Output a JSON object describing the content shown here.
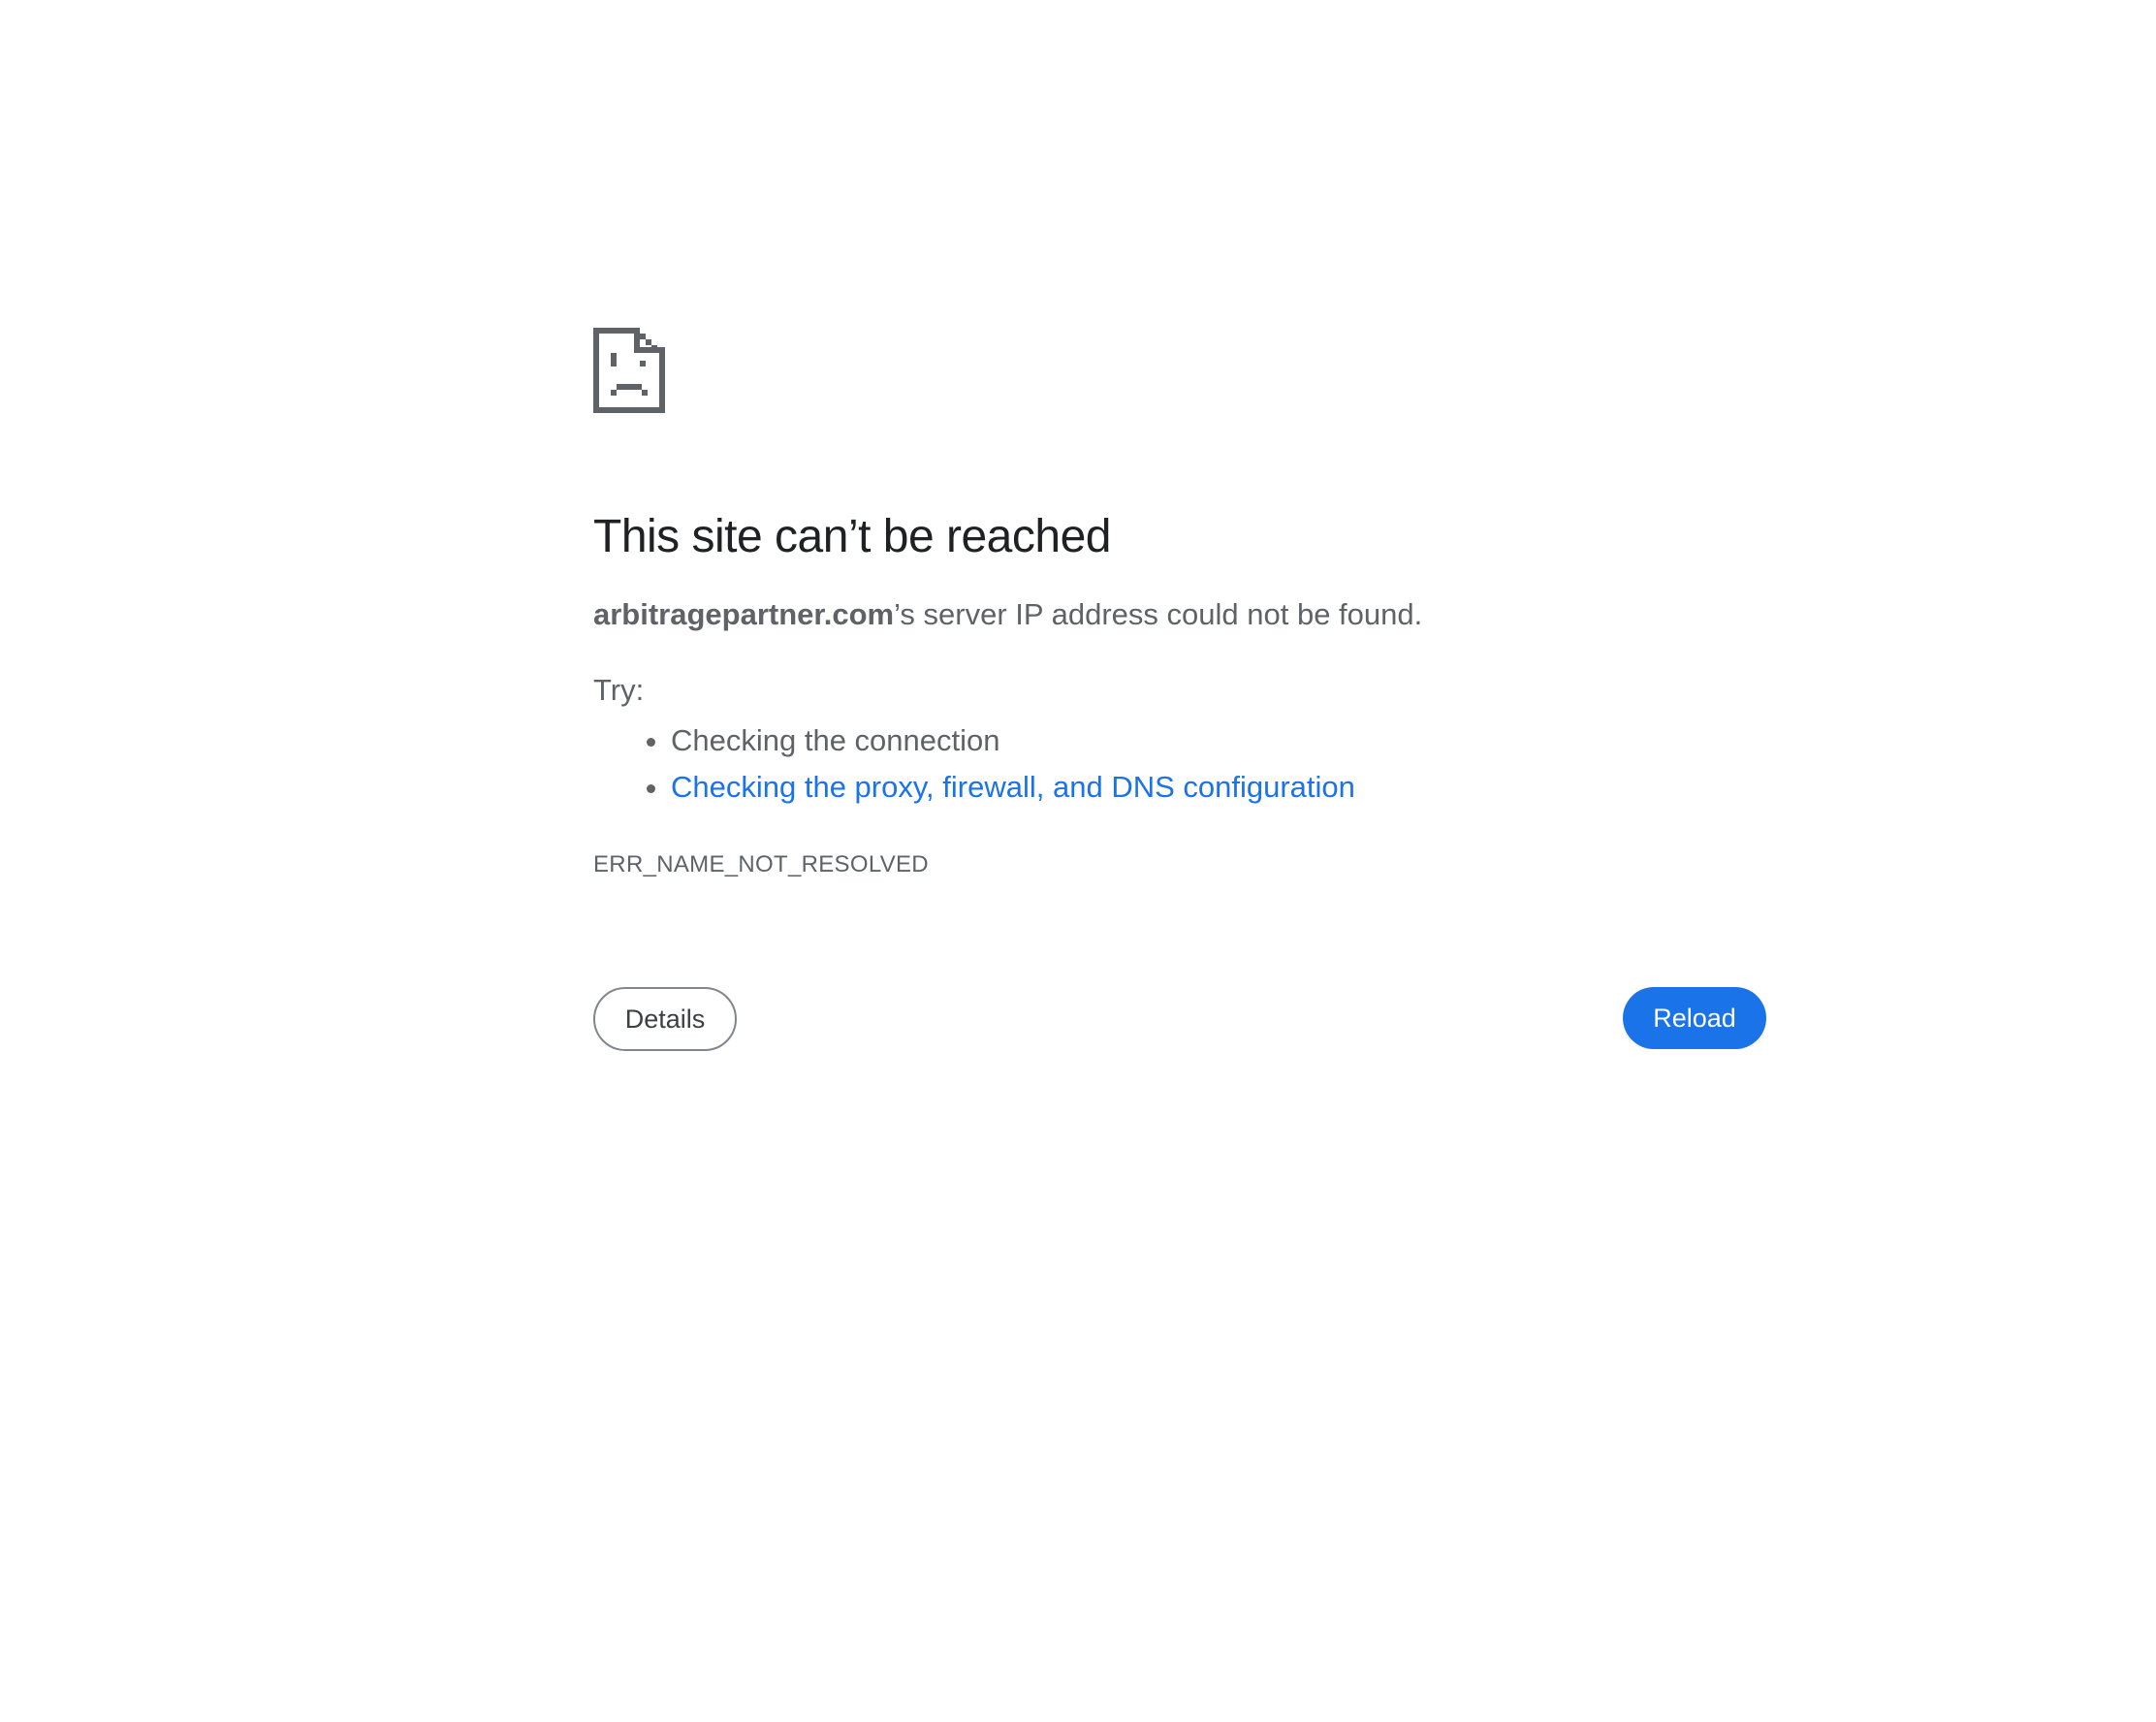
{
  "error_page": {
    "icon": "sad-page-icon",
    "title": "This site can’t be reached",
    "summary": {
      "host": "arbitragepartner.com",
      "message": "’s server IP address could not be found."
    },
    "try_label": "Try:",
    "suggestions": [
      {
        "text": "Checking the connection",
        "is_link": false
      },
      {
        "text": "Checking the proxy, firewall, and DNS configuration",
        "is_link": true
      }
    ],
    "error_code": "ERR_NAME_NOT_RESOLVED",
    "buttons": {
      "details_label": "Details",
      "reload_label": "Reload"
    }
  },
  "colors": {
    "title": "#202124",
    "body_text": "#5f6368",
    "link": "#1a73e8",
    "reload_bg": "#1a73e8",
    "details_border": "#80868b"
  }
}
